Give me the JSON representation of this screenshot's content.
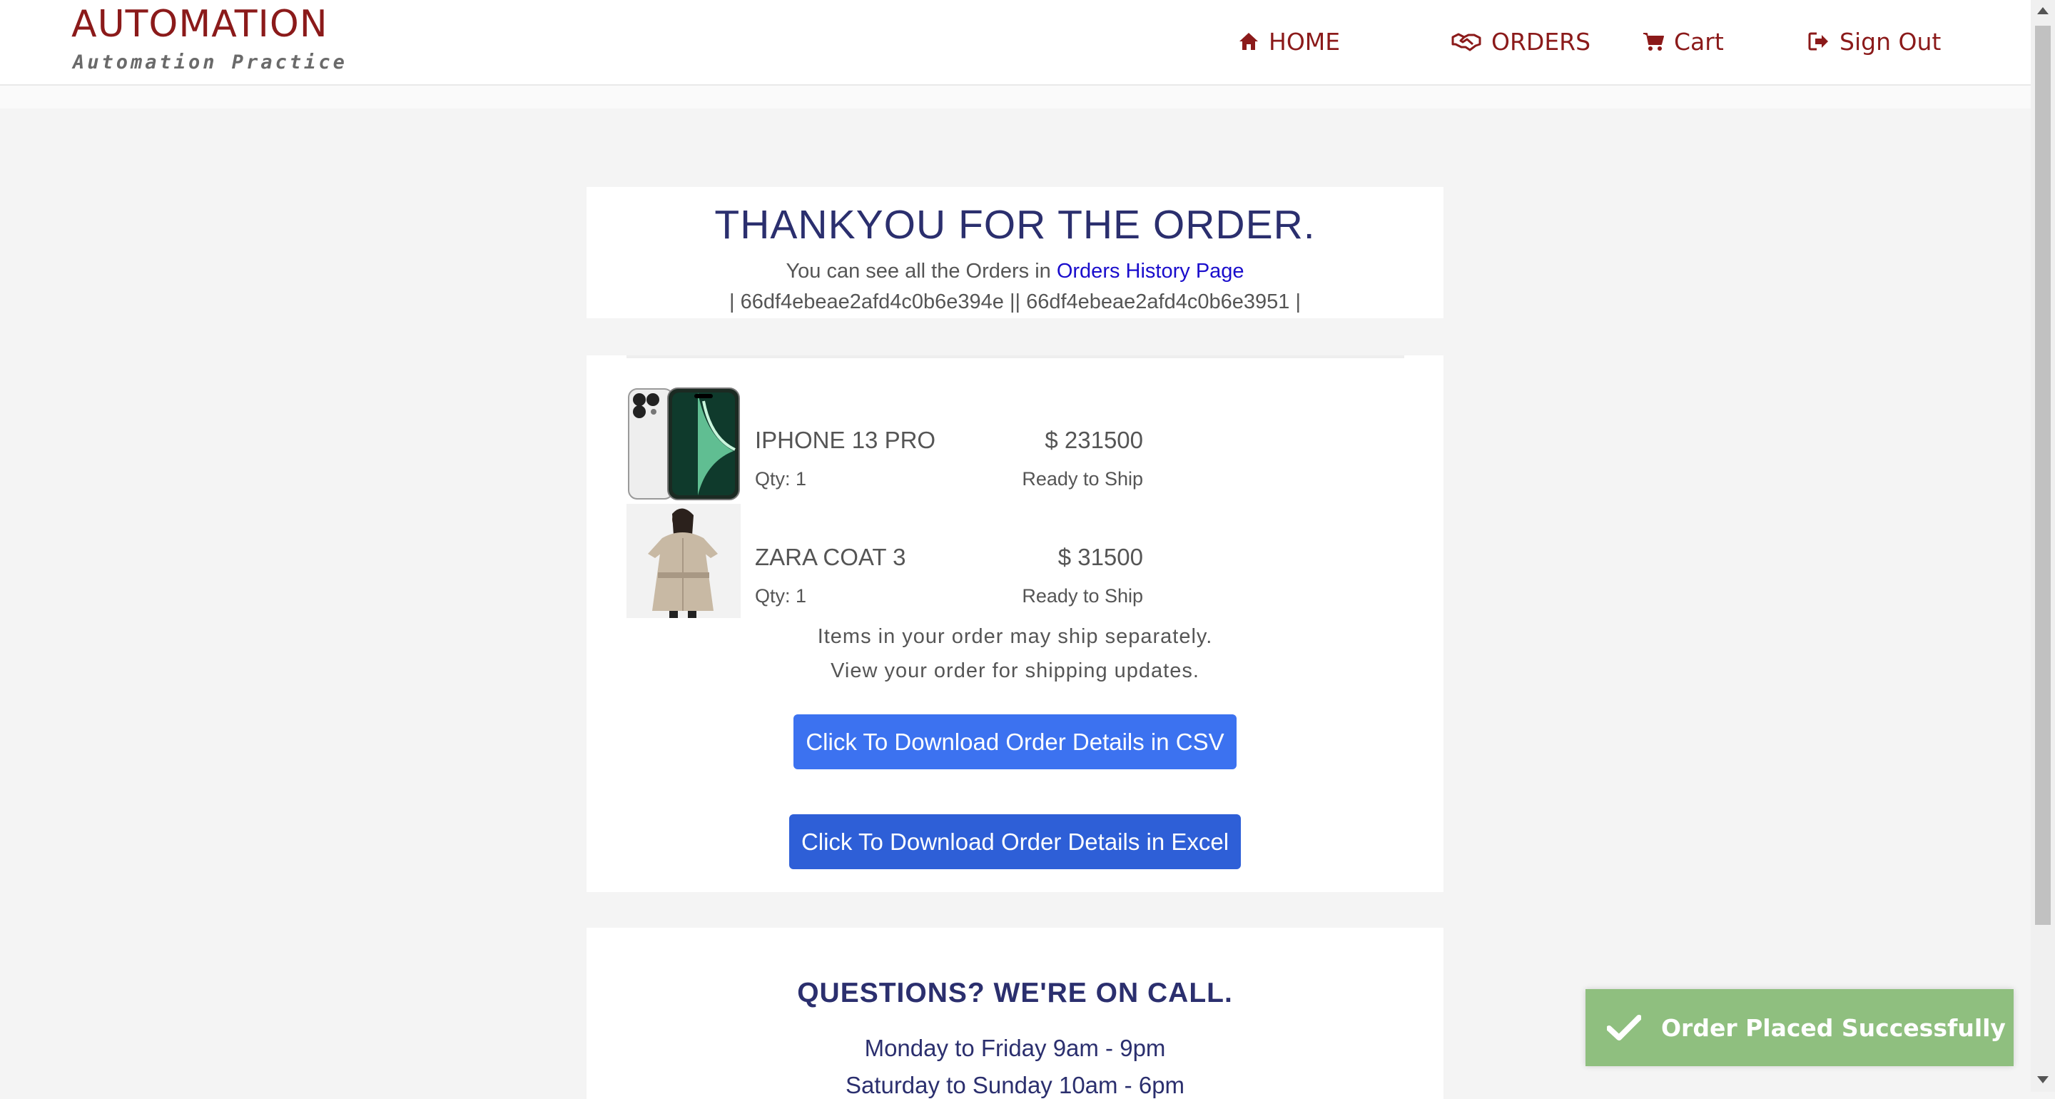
{
  "brand": {
    "title": "AUTOMATION",
    "subtitle": "Automation Practice",
    "color": "#8b1a1a"
  },
  "nav": {
    "home": "HOME",
    "orders": "ORDERS",
    "cart": "Cart",
    "sign_out": "Sign Out",
    "icons": [
      "home-icon",
      "handshake-icon",
      "cart-icon",
      "sign-out-icon"
    ]
  },
  "confirmation": {
    "title": "THANKYOU FOR THE ORDER.",
    "line_prefix": "You can see all the Orders in",
    "link_text": "Orders History Page",
    "order_ids": "| 66df4ebeae2afd4c0b6e394e || 66df4ebeae2afd4c0b6e3951 |"
  },
  "items": [
    {
      "name": "IPHONE 13 PRO",
      "price": "$ 231500",
      "qty": "Qty: 1",
      "status": "Ready to Ship",
      "image": "iphone-image"
    },
    {
      "name": "ZARA COAT 3",
      "price": "$ 31500",
      "qty": "Qty: 1",
      "status": "Ready to Ship",
      "image": "coat-image"
    }
  ],
  "shipping_note": {
    "line1": "Items in your order may ship separately.",
    "line2": "View your order for shipping updates."
  },
  "buttons": {
    "csv": "Click To Download Order Details in CSV",
    "excel": "Click To Download Order Details in Excel"
  },
  "questions": {
    "title": "QUESTIONS? WE'RE ON CALL.",
    "hours": "Monday to Friday 9am - 9pm",
    "hours_weekend": "Saturday to Sunday 10am - 6pm"
  },
  "toast": {
    "message": "Order Placed Successfully",
    "icon": "check-icon",
    "color": "#8fbf7f"
  },
  "colors": {
    "accent": "#2b2f6e",
    "button": "#3c72f0",
    "link": "#1a0dcc"
  }
}
